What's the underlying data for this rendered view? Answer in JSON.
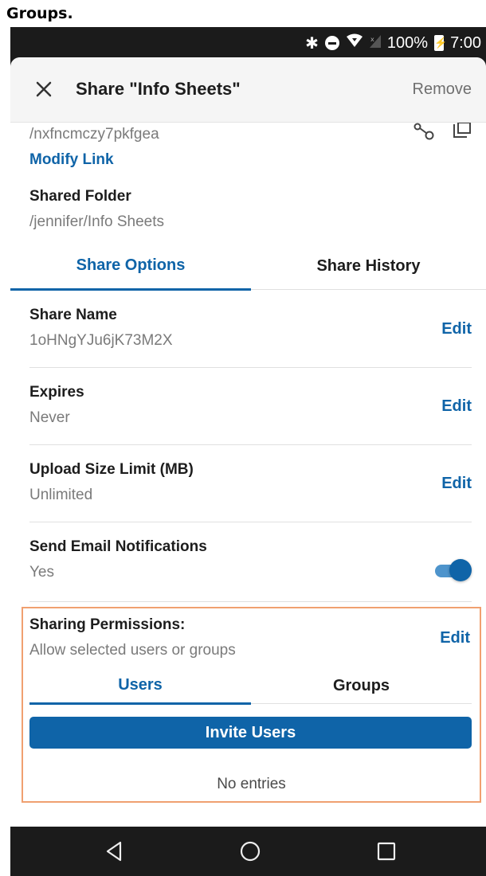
{
  "caption": "Groups.",
  "status_bar": {
    "battery_percent": "100%",
    "time": "7:00",
    "icons": [
      "bluetooth-icon",
      "do-not-disturb-icon",
      "wifi-icon",
      "signal-icon",
      "battery-charging-icon"
    ]
  },
  "header": {
    "title": "Share \"Info Sheets\"",
    "remove_label": "Remove",
    "close_icon": "close-icon"
  },
  "share_link": {
    "path": "/nxfncmczy7pkfgea",
    "modify_label": "Modify Link",
    "icons": [
      "share-link-icon",
      "copy-icon"
    ]
  },
  "shared_folder": {
    "label": "Shared Folder",
    "value": "/jennifer/Info Sheets"
  },
  "tabs": [
    {
      "label": "Share Options",
      "active": true
    },
    {
      "label": "Share History",
      "active": false
    }
  ],
  "options": [
    {
      "label": "Share Name",
      "value": "1oHNgYJu6jK73M2X",
      "action": "Edit"
    },
    {
      "label": "Expires",
      "value": "Never",
      "action": "Edit"
    },
    {
      "label": "Upload Size Limit (MB)",
      "value": "Unlimited",
      "action": "Edit"
    },
    {
      "label": "Send Email Notifications",
      "value": "Yes",
      "toggle_on": true
    }
  ],
  "permissions": {
    "title": "Sharing Permissions:",
    "description": "Allow selected users or groups",
    "action": "Edit",
    "tabs": [
      {
        "label": "Users",
        "active": true
      },
      {
        "label": "Groups",
        "active": false
      }
    ],
    "invite_label": "Invite Users",
    "empty_text": "No entries"
  },
  "colors": {
    "accent": "#0f64a8",
    "highlight_border": "#f0a070",
    "muted_text": "#7a7a7a"
  },
  "nav_bar": [
    "back-icon",
    "home-icon",
    "recents-icon"
  ]
}
